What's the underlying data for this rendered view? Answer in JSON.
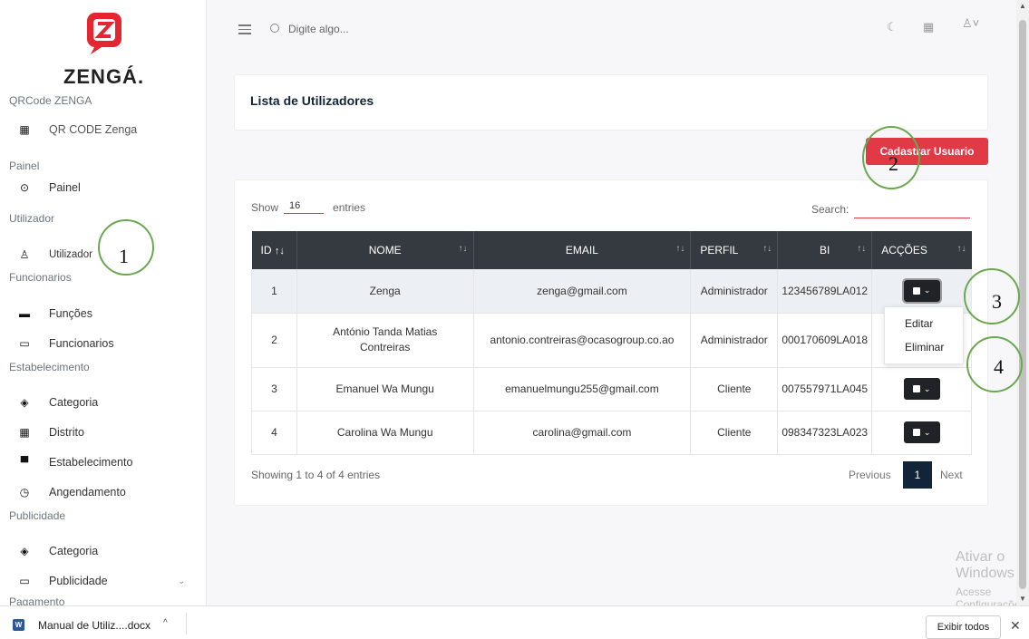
{
  "sidebar": {
    "brand": "ZENGÁ.",
    "sections": {
      "qrcode": "QRCode ZENGA",
      "painel": "Painel",
      "utilizador": "Utilizador",
      "funcionarios": "Funcionarios",
      "estabelecimento": "Estabelecimento",
      "publicidade": "Publicidade",
      "pagamento": "Pagamento"
    },
    "items": {
      "qr": "QR CODE Zenga",
      "painel": "Painel",
      "utilizador": "Utilizador",
      "funcoes": "Funções",
      "funcionarios": "Funcionarios",
      "categoria1": "Categoria",
      "distrito": "Distrito",
      "estabelecimento": "Estabelecimento",
      "angendamento": "Angendamento",
      "categoria2": "Categoria",
      "publicidade": "Publicidade"
    }
  },
  "topbar": {
    "search_placeholder": "Digite algo..."
  },
  "page": {
    "title": "Lista de Utilizadores",
    "add_button": "Cadastrar Usuario",
    "show_label": "Show",
    "entries_value": "16",
    "entries_label": "entries",
    "search_label": "Search:",
    "showing": "Showing 1 to 4 of 4 entries",
    "prev": "Previous",
    "page_current": "1",
    "next": "Next"
  },
  "table": {
    "headers": [
      "ID",
      "NOME",
      "EMAIL",
      "PERFIL",
      "BI",
      "ACÇÕES"
    ],
    "rows": [
      {
        "id": "1",
        "nome": "Zenga",
        "email": "zenga@gmail.com",
        "perfil": "Administrador",
        "bi": "123456789LA012"
      },
      {
        "id": "2",
        "nome": "António Tanda Matias Contreiras",
        "email": "antonio.contreiras@ocasogroup.co.ao",
        "perfil": "Administrador",
        "bi": "000170609LA018"
      },
      {
        "id": "3",
        "nome": "Emanuel Wa Mungu",
        "email": "emanuelmungu255@gmail.com",
        "perfil": "Cliente",
        "bi": "007557971LA045"
      },
      {
        "id": "4",
        "nome": "Carolina Wa Mungu",
        "email": "carolina@gmail.com",
        "perfil": "Cliente",
        "bi": "098347323LA023"
      }
    ]
  },
  "dropdown": {
    "edit": "Editar",
    "delete": "Eliminar"
  },
  "watermark": {
    "line1": "Ativar o Windows",
    "line2": "Acesse Configurações para ativar o Windows."
  },
  "annotations": [
    "1",
    "2",
    "3",
    "4"
  ],
  "download_bar": {
    "file": "Manual de Utiliz....docx",
    "show_all": "Exibir todos"
  },
  "colors": {
    "accent": "#e03a47",
    "header_dark": "#343a40",
    "annotation": "#6aa84f",
    "page_active": "#12243a"
  }
}
